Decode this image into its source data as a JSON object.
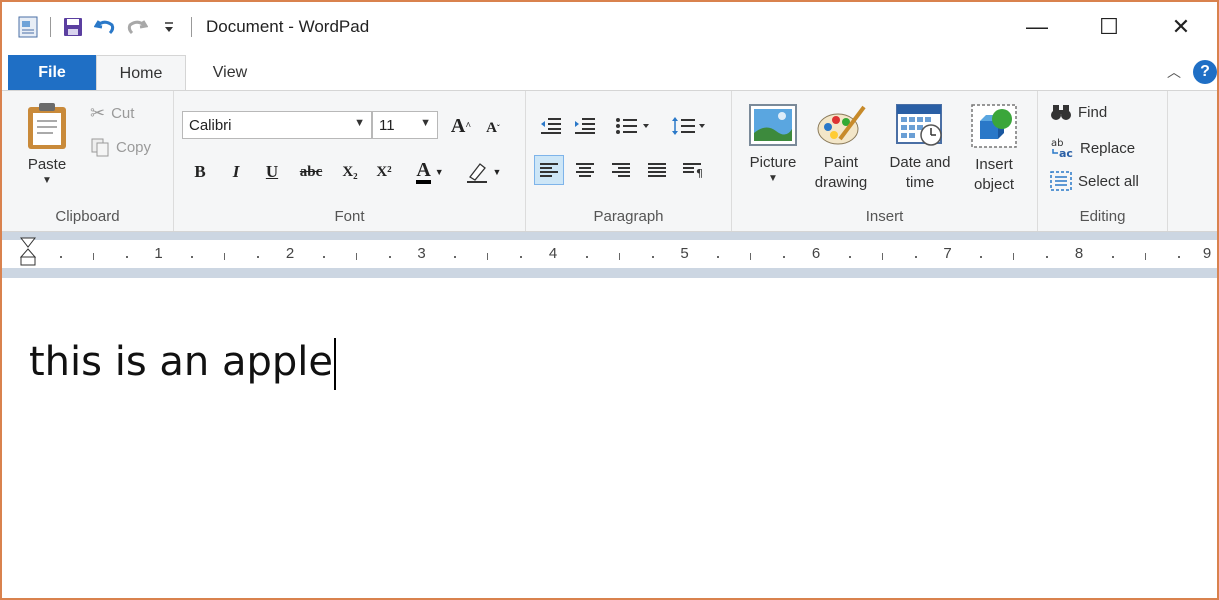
{
  "window": {
    "title": "Document - WordPad",
    "controls": {
      "minimize": "—",
      "maximize": "☐",
      "close": "✕"
    }
  },
  "quick_access": {
    "icons": [
      "wordpad-app-icon",
      "save-icon",
      "undo-icon",
      "redo-icon",
      "customize-dropdown-icon"
    ]
  },
  "tabs": {
    "file": "File",
    "home": "Home",
    "view": "View",
    "help": "?"
  },
  "ribbon": {
    "clipboard": {
      "label": "Clipboard",
      "paste": "Paste",
      "cut": "Cut",
      "copy": "Copy"
    },
    "font": {
      "label": "Font",
      "family": "Calibri",
      "size": "11",
      "bold": "B",
      "italic": "I",
      "underline": "U",
      "strike": "abc",
      "subscript": "X₂",
      "superscript": "X²",
      "color": "A"
    },
    "paragraph": {
      "label": "Paragraph"
    },
    "insert": {
      "label": "Insert",
      "picture": "Picture",
      "paint_line1": "Paint",
      "paint_line2": "drawing",
      "datetime_line1": "Date and",
      "datetime_line2": "time",
      "object_line1": "Insert",
      "object_line2": "object"
    },
    "editing": {
      "label": "Editing",
      "find": "Find",
      "replace": "Replace",
      "select_all": "Select all"
    }
  },
  "ruler": {
    "numbers": [
      "1",
      "2",
      "3",
      "4",
      "5",
      "6",
      "7",
      "8",
      "9"
    ]
  },
  "document": {
    "text": "this is an apple"
  },
  "colors": {
    "accent": "#1f6fc5",
    "window_border": "#d9824e",
    "ribbon_bg": "#f5f6f7",
    "ruler_bg": "#ccd6e2"
  }
}
